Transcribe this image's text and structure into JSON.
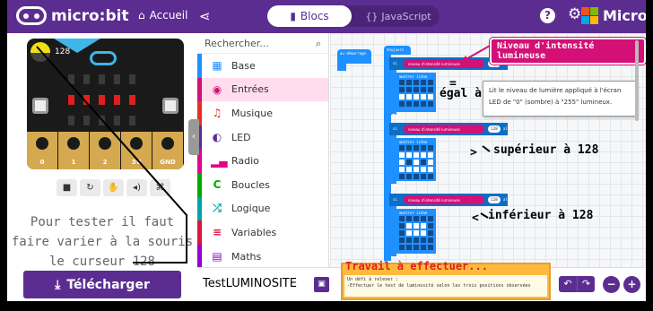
{
  "header": {
    "brand": "micro:bit",
    "home_label": "Accueil",
    "tab_blocks": "Blocs",
    "tab_js": "JavaScript",
    "microsoft": "Microsoft"
  },
  "simulator": {
    "light_value": "128",
    "pins": [
      "0",
      "1",
      "2",
      "3V",
      "GND"
    ],
    "note_lines": [
      "Pour tester il faut",
      "faire varier à la souris",
      "le curseur 128"
    ],
    "download_label": "Télécharger"
  },
  "toolbox": {
    "search_placeholder": "Rechercher...",
    "categories": [
      {
        "label": "Base",
        "color": "#1e90ff",
        "icon": "grid-icon"
      },
      {
        "label": "Entrées",
        "color": "#d40f75",
        "icon": "target-icon"
      },
      {
        "label": "Musique",
        "color": "#e63022",
        "icon": "headphones-icon"
      },
      {
        "label": "LED",
        "color": "#5c2d91",
        "icon": "toggle-icon"
      },
      {
        "label": "Radio",
        "color": "#e3008c",
        "icon": "signal-icon"
      },
      {
        "label": "Boucles",
        "color": "#00aa00",
        "icon": "loop-icon"
      },
      {
        "label": "Logique",
        "color": "#00a4a6",
        "icon": "shuffle-icon"
      },
      {
        "label": "Variables",
        "color": "#dc143c",
        "icon": "list-icon"
      },
      {
        "label": "Maths",
        "color": "#9400d3",
        "icon": "calculator-icon"
      }
    ]
  },
  "workspace": {
    "on_start": "au démarrage",
    "forever": "toujours",
    "if_label": "si",
    "then_label": "alors",
    "show_icon": "montrer icône",
    "light_block": "niveau d'intensité lumineuse",
    "light_value": "128",
    "tooltip": "Lit le niveau de lumière appliqué à l'écran LED de \"0\" (sombre) à \"255\" lumineux.",
    "annotations": {
      "title": "Niveau d'intensité lumineuse",
      "equal_sym": "=",
      "equal": "égal à",
      "greater_sym": ">",
      "greater": "supérieur à 128",
      "less_sym": "<",
      "less": "inférieur à 128"
    }
  },
  "footer": {
    "project_name": "TestLUMINOSITE",
    "task_title": "Travail à effectuer...",
    "task_line1": "Un défi à relever :",
    "task_line2": "-Effectuer le test de luminosité selon les trois positions observées"
  },
  "colors": {
    "brand": "#5c2d91",
    "block_blue": "#1e90ff",
    "input_pink": "#d40f75",
    "task_orange": "#ffb93d"
  }
}
